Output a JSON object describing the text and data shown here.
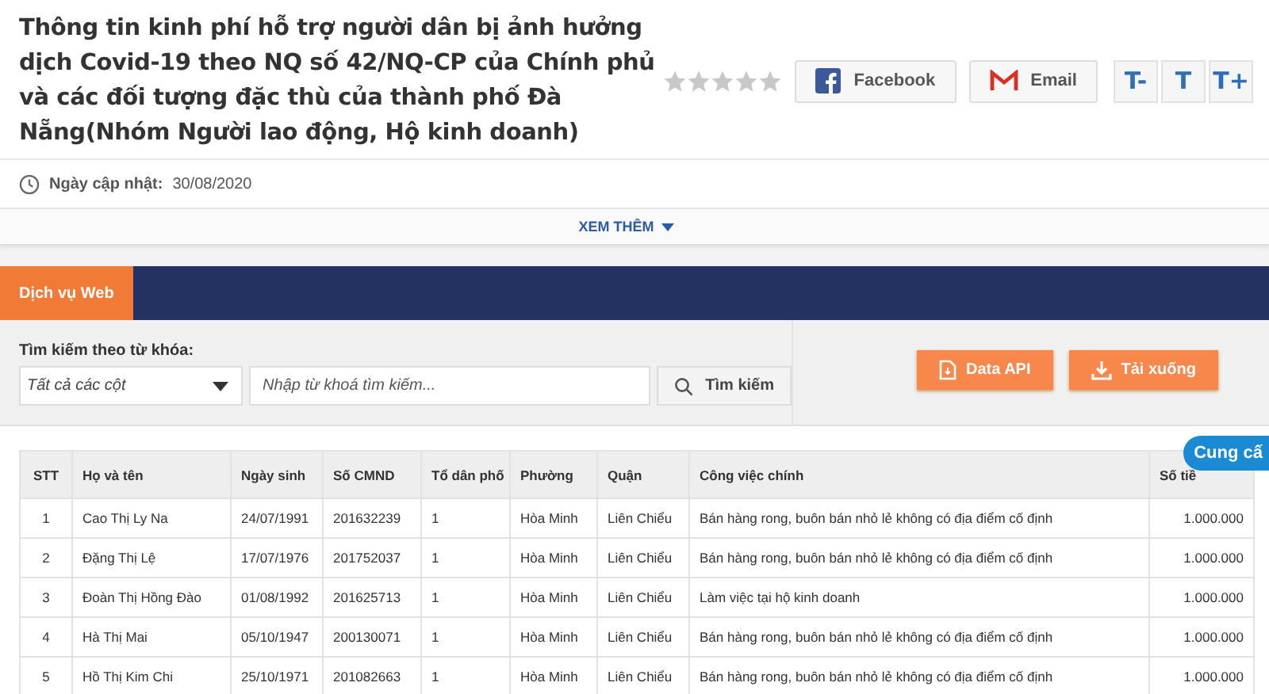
{
  "article": {
    "title": "Thông tin kinh phí hỗ trợ người dân bị ảnh hưởng dịch Covid-19 theo NQ số 42/NQ-CP của Chính phủ và các đối tượng đặc thù của thành phố Đà Nẵng(Nhóm Người lao động, Hộ kinh doanh)",
    "stars": 0,
    "share_buttons": [
      "Facebook",
      "Email"
    ],
    "font_buttons": [
      "T-",
      "T",
      "T+"
    ],
    "updated_label": "Ngày cập nhật:",
    "updated_date": "30/08/2020",
    "more": "XEM THÊM"
  },
  "tabs": [
    {
      "label": "Dịch vụ Web",
      "selected": true
    }
  ],
  "search": {
    "label": "Tìm kiếm theo từ khóa:",
    "column_select": "Tất cả các cột",
    "placeholder": "Nhập từ khoá tìm kiếm...",
    "button": "Tìm kiếm"
  },
  "actions": [
    "Data API",
    "Tải xuống"
  ],
  "table": {
    "columns": [
      "STT",
      "Họ và tên",
      "Ngày sinh",
      "Số CMND",
      "Tổ dân phố",
      "Phường",
      "Quận",
      "Công việc chính",
      "Số tiề"
    ],
    "rows": [
      [
        "1",
        "Cao Thị Ly Na",
        "24/07/1991",
        "201632239",
        "1",
        "Hòa Minh",
        "Liên Chiểu",
        "Bán hàng rong, buôn bán nhỏ lẻ không có địa điểm cố định",
        "1.000.000"
      ],
      [
        "2",
        "Đặng Thị Lệ",
        "17/07/1976",
        "201752037",
        "1",
        "Hòa Minh",
        "Liên Chiểu",
        "Bán hàng rong, buôn bán nhỏ lẻ không có địa điểm cố định",
        "1.000.000"
      ],
      [
        "3",
        "Đoàn Thị Hồng Đào",
        "01/08/1992",
        "201625713",
        "1",
        "Hòa Minh",
        "Liên Chiểu",
        "Làm việc tại hộ kinh doanh",
        "1.000.000"
      ],
      [
        "4",
        "Hà Thị Mai",
        "05/10/1947",
        "200130071",
        "1",
        "Hòa Minh",
        "Liên Chiểu",
        "Bán hàng rong, buôn bán nhỏ lẻ không có địa điểm cố định",
        "1.000.000"
      ],
      [
        "5",
        "Hồ Thị Kim Chi",
        "25/10/1971",
        "201082663",
        "1",
        "Hòa Minh",
        "Liên Chiểu",
        "Bán hàng rong, buôn bán nhỏ lẻ không có địa điểm cố định",
        "1.000.000"
      ]
    ]
  },
  "floating_badge": "Cung cấ"
}
